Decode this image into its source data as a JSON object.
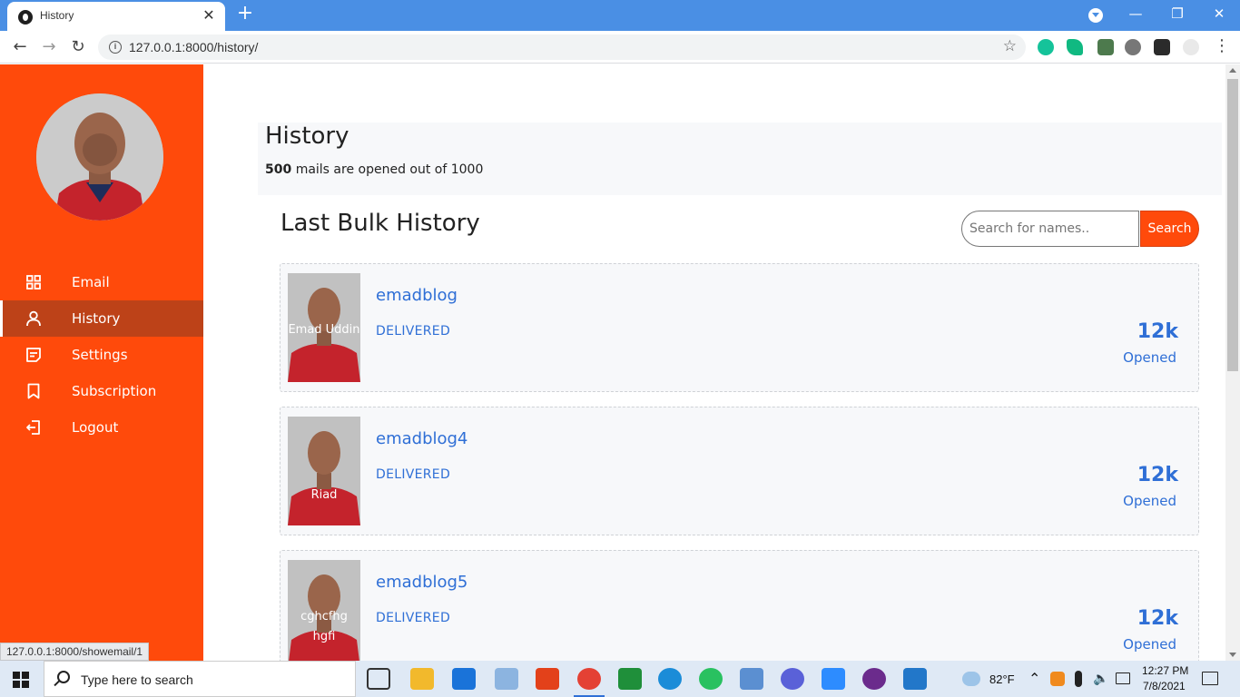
{
  "browser": {
    "tab_title": "History",
    "tab_close": "✕",
    "new_tab": "+",
    "url": "127.0.0.1:8000/history/",
    "back": "←",
    "forward": "→",
    "reload": "↻",
    "info": "i",
    "star": "☆",
    "minimize": "—",
    "restore": "❐",
    "close": "✕",
    "status_url": "127.0.0.1:8000/showemail/1"
  },
  "sidebar": {
    "items": [
      {
        "label": "Email",
        "icon": "grid-icon"
      },
      {
        "label": "History",
        "icon": "user-icon"
      },
      {
        "label": "Settings",
        "icon": "document-icon"
      },
      {
        "label": "Subscription",
        "icon": "bookmark-icon"
      },
      {
        "label": "Logout",
        "icon": "logout-icon"
      }
    ],
    "active": "History",
    "accent_color": "#ff4a0b",
    "active_color": "#bd4218"
  },
  "header": {
    "title": "History",
    "opened_count": "500",
    "opened_text": "mails are opened out of 1000"
  },
  "bulk": {
    "title": "Last Bulk History",
    "search_placeholder": "Search for names..",
    "search_button": "Search",
    "cards": [
      {
        "thumb_text": "Emad Uddin",
        "name": "emadblog",
        "status": "DELIVERED",
        "count": "12k",
        "count_label": "Opened"
      },
      {
        "thumb_text": "Riad",
        "name": "emadblog4",
        "status": "DELIVERED",
        "count": "12k",
        "count_label": "Opened"
      },
      {
        "thumb_text": "cghcfhg hgfi",
        "name": "emadblog5",
        "status": "DELIVERED",
        "count": "12k",
        "count_label": "Opened"
      }
    ]
  },
  "taskbar": {
    "search_placeholder": "Type here to search",
    "weather": "82°F",
    "time": "12:27 PM",
    "date": "7/8/2021"
  }
}
